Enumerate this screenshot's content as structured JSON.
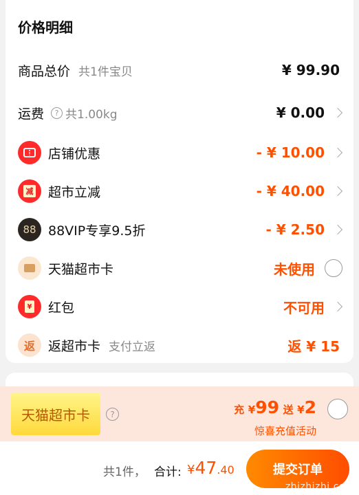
{
  "price_detail": {
    "title": "价格明细",
    "subtotal": {
      "label": "商品总价",
      "sub": "共1件宝贝",
      "value": "¥ 99.90"
    },
    "shipping": {
      "label": "运费",
      "help": "?",
      "sub": "共1.00kg",
      "value": "¥ 0.00"
    },
    "store_discount": {
      "label": "店铺优惠",
      "value": "- ¥ 10.00",
      "icon": "ticket-icon"
    },
    "supermarket_cut": {
      "label": "超市立减",
      "icon_text": "减",
      "value": "- ¥ 40.00"
    },
    "vip": {
      "label": "88VIP专享9.5折",
      "icon_text": "88",
      "value": "- ¥ 2.50"
    },
    "tmall_card": {
      "label": "天猫超市卡",
      "value": "未使用",
      "icon": "card-icon"
    },
    "red_packet": {
      "label": "红包",
      "icon_text": "¥",
      "value": "不可用"
    },
    "rebate_card": {
      "label": "返超市卡",
      "icon_text": "返",
      "sub": "支付立返",
      "value": "返 ¥ 15"
    }
  },
  "promo": {
    "badge": "天猫超市卡",
    "help": "?",
    "charge_label": "充",
    "charge_currency": "¥",
    "charge_amount": "99",
    "gift_label": "送",
    "gift_currency": "¥",
    "gift_amount": "2",
    "activity": "惊喜充值活动"
  },
  "footer": {
    "count": "共1件，",
    "total_label": "合计:",
    "total_currency": "¥",
    "total_int": "47",
    "total_dec": ".40",
    "submit": "提交订单"
  },
  "watermark": "zhizhizhi.com",
  "colors": {
    "accent": "#ff5000",
    "vip_bg": "#2a2521"
  }
}
